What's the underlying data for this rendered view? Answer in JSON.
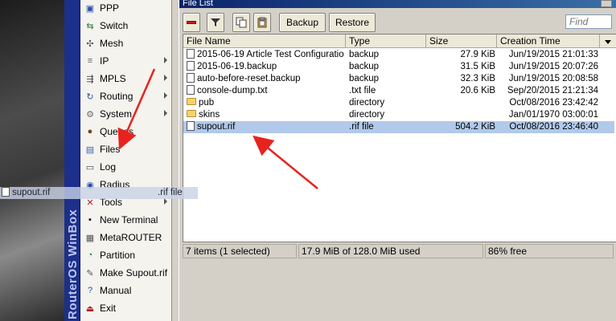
{
  "sidebar": {
    "brand": "RouterOS WinBox",
    "items": [
      {
        "label": "PPP",
        "icon": "ppp-icon",
        "arrow": false
      },
      {
        "label": "Switch",
        "icon": "switch-icon",
        "arrow": false
      },
      {
        "label": "Mesh",
        "icon": "mesh-icon",
        "arrow": false
      },
      {
        "label": "IP",
        "icon": "ip-icon",
        "arrow": true
      },
      {
        "label": "MPLS",
        "icon": "mpls-icon",
        "arrow": true
      },
      {
        "label": "Routing",
        "icon": "routing-icon",
        "arrow": true
      },
      {
        "label": "System",
        "icon": "system-icon",
        "arrow": true
      },
      {
        "label": "Queues",
        "icon": "queues-icon",
        "arrow": false
      },
      {
        "label": "Files",
        "icon": "files-icon",
        "arrow": false
      },
      {
        "label": "Log",
        "icon": "log-icon",
        "arrow": false
      },
      {
        "label": "Radius",
        "icon": "radius-icon",
        "arrow": false
      },
      {
        "label": "Tools",
        "icon": "tools-icon",
        "arrow": true
      },
      {
        "label": "New Terminal",
        "icon": "terminal-icon",
        "arrow": false
      },
      {
        "label": "MetaROUTER",
        "icon": "metarouter-icon",
        "arrow": false
      },
      {
        "label": "Partition",
        "icon": "partition-icon",
        "arrow": false
      },
      {
        "label": "Make Supout.rif",
        "icon": "supout-icon",
        "arrow": false
      },
      {
        "label": "Manual",
        "icon": "manual-icon",
        "arrow": false
      },
      {
        "label": "Exit",
        "icon": "exit-icon",
        "arrow": false
      }
    ]
  },
  "window": {
    "title": "File List",
    "toolbar": {
      "backup_label": "Backup",
      "restore_label": "Restore",
      "find_placeholder": "Find"
    },
    "columns": [
      "File Name",
      "Type",
      "Size",
      "Creation Time"
    ],
    "rows": [
      {
        "name": "2015-06-19 Article Test Configuratio...",
        "type": "backup",
        "size": "27.9 KiB",
        "time": "Jun/19/2015 21:01:33",
        "kind": "file",
        "selected": false
      },
      {
        "name": "2015-06-19.backup",
        "type": "backup",
        "size": "31.5 KiB",
        "time": "Jun/19/2015 20:07:26",
        "kind": "file",
        "selected": false
      },
      {
        "name": "auto-before-reset.backup",
        "type": "backup",
        "size": "32.3 KiB",
        "time": "Jun/19/2015 20:08:58",
        "kind": "file",
        "selected": false
      },
      {
        "name": "console-dump.txt",
        "type": ".txt file",
        "size": "20.6 KiB",
        "time": "Sep/20/2015 21:21:34",
        "kind": "file",
        "selected": false
      },
      {
        "name": "pub",
        "type": "directory",
        "size": "",
        "time": "Oct/08/2016 23:42:42",
        "kind": "folder",
        "selected": false
      },
      {
        "name": "skins",
        "type": "directory",
        "size": "",
        "time": "Jan/01/1970 03:00:01",
        "kind": "folder",
        "selected": false
      },
      {
        "name": "supout.rif",
        "type": ".rif file",
        "size": "504.2 KiB",
        "time": "Oct/08/2016 23:46:40",
        "kind": "file",
        "selected": true
      }
    ],
    "status": {
      "count": "7 items (1 selected)",
      "usage": "17.9 MiB of 128.0 MiB used",
      "free": "86% free"
    }
  },
  "drag_ghost": {
    "name": "supout.rif",
    "type": ".rif file"
  },
  "colors": {
    "sidebar_bar": "#1c2f8a",
    "selection": "#b1c9ea",
    "arrow": "#e8231f"
  }
}
